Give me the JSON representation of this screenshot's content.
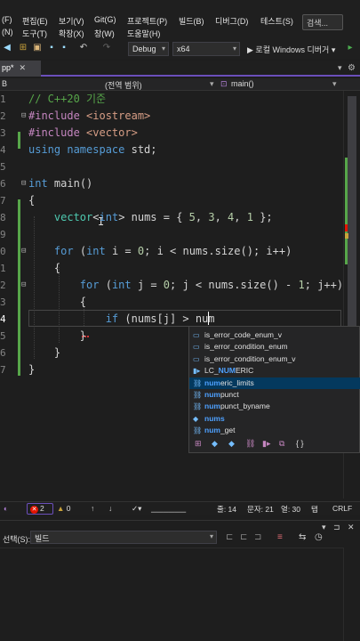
{
  "menu": {
    "row1": [
      "(F)",
      "편집(E)",
      "보기(V)",
      "Git(G)",
      "프로젝트(P)",
      "빌드(B)",
      "디버그(D)",
      "테스트(S)"
    ],
    "row2": [
      "(N)",
      "도구(T)",
      "확장(X)",
      "창(W)",
      "도움말(H)"
    ],
    "search_label": "검색..."
  },
  "toolbar": {
    "config": "Debug",
    "platform": "x64",
    "run_label": "▶ 로컬 Windows 디버거 ▾",
    "more": "▸"
  },
  "tab": {
    "label": "pp*",
    "close": "✕"
  },
  "navbar": {
    "scope": "B",
    "scope_global": "(전역 범위)",
    "function": "main()"
  },
  "code_lines": [
    {
      "n": "1",
      "html": "<span class=\"cm\">// C++20 기준</span>"
    },
    {
      "n": "2",
      "html": "<span class=\"pp\">#include</span> <span class=\"str\">&lt;iostream&gt;</span>"
    },
    {
      "n": "3",
      "html": "<span class=\"pp\">#include</span> <span class=\"str\">&lt;vector&gt;</span>"
    },
    {
      "n": "4",
      "html": "<span class=\"kw\">using namespace</span> <span class=\"pl\">std;</span>"
    },
    {
      "n": "5",
      "html": ""
    },
    {
      "n": "6",
      "html": "<span class=\"kw\">int</span> <span class=\"pl\">main()</span>"
    },
    {
      "n": "7",
      "html": "<span class=\"pl\">{</span>"
    },
    {
      "n": "8",
      "html": "    <span class=\"ty\">vector</span><span class=\"pl\">&lt;</span><span class=\"kw\">int</span><span class=\"pl\">&gt; nums = { </span><span class=\"num\">5</span><span class=\"pl\">, </span><span class=\"num\">3</span><span class=\"pl\">, </span><span class=\"num\">4</span><span class=\"pl\">, </span><span class=\"num\">1</span><span class=\"pl\"> };</span>"
    },
    {
      "n": "9",
      "html": ""
    },
    {
      "n": "0",
      "html": "    <span class=\"kw\">for</span> <span class=\"pl\">(</span><span class=\"kw\">int</span> <span class=\"pl\">i = </span><span class=\"num\">0</span><span class=\"pl\">; i &lt; nums.size(); i++)</span>"
    },
    {
      "n": "1",
      "html": "    <span class=\"pl\">{</span>"
    },
    {
      "n": "2",
      "html": "        <span class=\"kw\">for</span> <span class=\"pl\">(</span><span class=\"kw\">int</span> <span class=\"pl\">j = </span><span class=\"num\">0</span><span class=\"pl\">; j &lt; nums.size() - </span><span class=\"num\">1</span><span class=\"pl\">; j++)</span>"
    },
    {
      "n": "3",
      "html": "        <span class=\"pl\">{</span>"
    },
    {
      "n": "4",
      "html": "            <span class=\"kw\">if</span> <span class=\"pl\">(nums[j] &gt; num</span>"
    },
    {
      "n": "5",
      "html": "        <span class=\"pl\">}</span>"
    },
    {
      "n": "6",
      "html": "    <span class=\"pl\">}</span>"
    },
    {
      "n": "7",
      "html": "<span class=\"pl\">}</span>"
    }
  ],
  "intellisense": {
    "items": [
      {
        "pre": "",
        "match": "",
        "rest": "is_error_code_enum_v",
        "icon": "▭"
      },
      {
        "pre": "",
        "match": "",
        "rest": "is_error_condition_enum",
        "icon": "▭"
      },
      {
        "pre": "",
        "match": "",
        "rest": "is_error_condition_enum_v",
        "icon": "▭"
      },
      {
        "pre": "LC_",
        "match": "NUM",
        "rest": "ERIC",
        "icon": "▮▸"
      },
      {
        "pre": "",
        "match": "num",
        "rest": "eric_limits",
        "icon": "⛓"
      },
      {
        "pre": "",
        "match": "num",
        "rest": "punct",
        "icon": "⛓"
      },
      {
        "pre": "",
        "match": "num",
        "rest": "punct_byname",
        "icon": "⛓"
      },
      {
        "pre": "",
        "match": "nums",
        "rest": "",
        "icon": "◆"
      },
      {
        "pre": "",
        "match": "num",
        "rest": "_get",
        "icon": "⛓"
      }
    ],
    "filters": [
      "⊞",
      "◆",
      "◆",
      "⛓",
      "▮▸",
      "⧉",
      "{ }"
    ]
  },
  "status": {
    "errors": "2",
    "warnings": "0",
    "line": "줄: 14",
    "col": "문자: 21",
    "pos": "열: 30",
    "tab": "탭",
    "eol": "CRLF"
  },
  "output": {
    "label": "선택(S):",
    "source": "빌드"
  }
}
